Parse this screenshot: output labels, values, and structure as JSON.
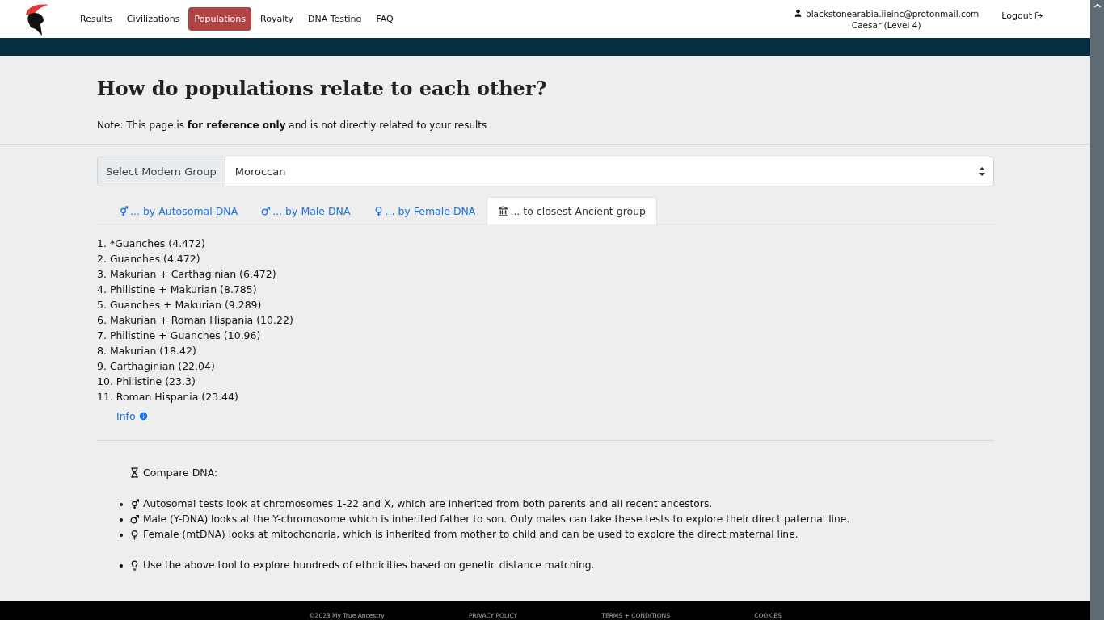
{
  "nav": {
    "items": [
      {
        "label": "Results",
        "selected": false
      },
      {
        "label": "Civilizations",
        "selected": false
      },
      {
        "label": "Populations",
        "selected": true
      },
      {
        "label": "Royalty",
        "selected": false
      },
      {
        "label": "DNA Testing",
        "selected": false
      },
      {
        "label": "FAQ",
        "selected": false
      }
    ],
    "user": {
      "email": "blackstonearabia.iieinc@protonmail.com",
      "level": "Caesar (Level 4)"
    },
    "logout": "Logout"
  },
  "heading": "How do populations relate to each other?",
  "note": "Note: This page is **for reference only** and is not directly related to your results",
  "select": {
    "label": "Select Modern Group",
    "value": "Moroccan"
  },
  "tabs": [
    {
      "kind": "autosomal",
      "label": "... by Autosomal DNA",
      "selected": false
    },
    {
      "kind": "male",
      "label": "... by Male DNA",
      "selected": false
    },
    {
      "kind": "female",
      "label": "... by Female DNA",
      "selected": false
    },
    {
      "kind": "ancient",
      "label": "... to closest Ancient group",
      "selected": true
    }
  ],
  "results": [
    "1. *Guanches (4.472)",
    "2. Guanches (4.472)",
    "3. Makurian + Carthaginian (6.472)",
    "4. Philistine + Makurian (8.785)",
    "5. Guanches + Makurian (9.289)",
    "6. Makurian + Roman Hispania (10.22)",
    "7. Philistine + Guanches (10.96)",
    "8. Makurian (18.42)",
    "9. Carthaginian (22.04)",
    "10. Philistine (23.3)",
    "11. Roman Hispania (23.44)"
  ],
  "info": "Info",
  "compare": {
    "title": "Compare DNA:",
    "items": [
      {
        "kind": "autosomal",
        "text": "Autosomal tests look at chromosomes 1-22 and X, which are inherited from both parents and all recent ancestors."
      },
      {
        "kind": "male",
        "text": "Male (Y-DNA) looks at the Y-chromosome which is inherited father to son. Only males can take these tests to explore their direct paternal line."
      },
      {
        "kind": "female",
        "text": "Female (mtDNA) looks at mitochondria, which is inherited from mother to child and can be used to explore the direct maternal line."
      },
      {
        "kind": "tip",
        "text": "Use the above tool to explore hundreds of ethnicities based on genetic distance matching."
      }
    ]
  },
  "footer": [
    "©2023 My True Ancestry",
    "PRIVACY POLICY",
    "TERMS + CONDITIONS",
    "COOKIES"
  ]
}
